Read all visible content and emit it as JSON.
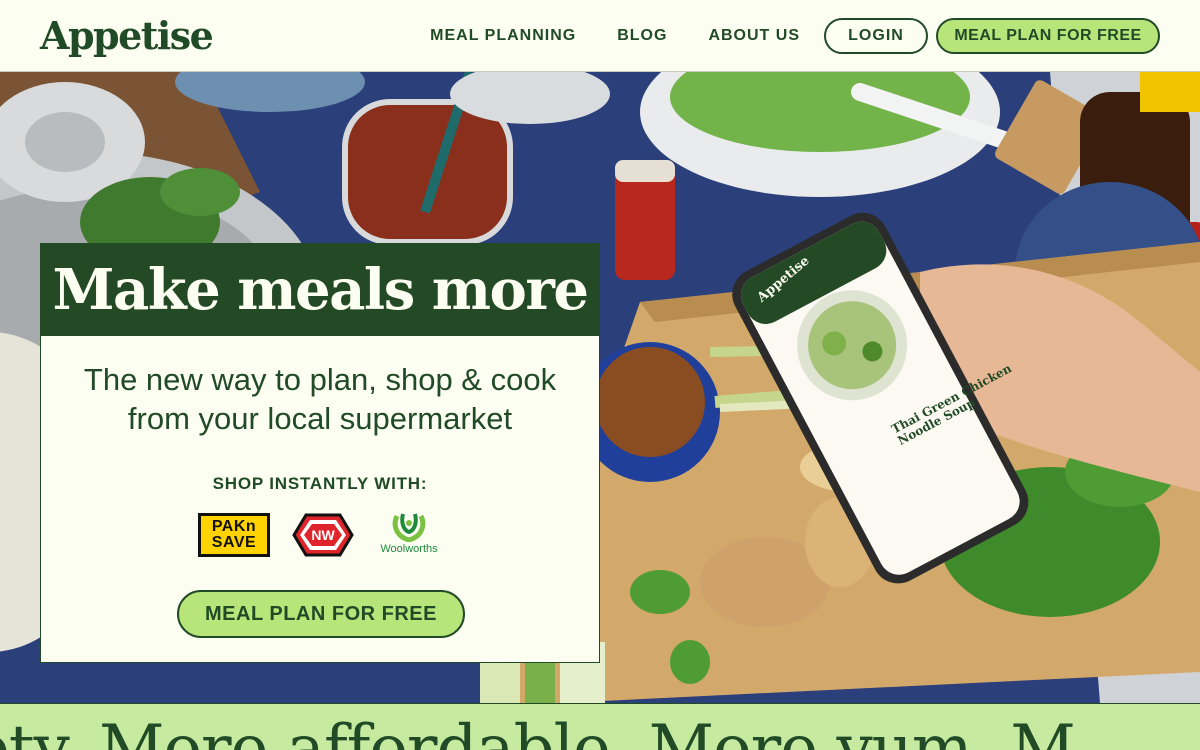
{
  "header": {
    "logo": "Appetise",
    "nav": [
      "MEAL PLANNING",
      "BLOG",
      "ABOUT US"
    ],
    "login_label": "LOGIN",
    "cta_label": "MEAL PLAN FOR FREE"
  },
  "hero": {
    "title": "Make meals more",
    "subtitle_line1": "The new way to plan, shop & cook",
    "subtitle_line2": "from your local supermarket",
    "shop_label": "SHOP INSTANTLY WITH:",
    "stores": {
      "paknsave_line1": "PAKn",
      "paknsave_line2": "SAVE",
      "newworld": "NW",
      "woolworths": "Woolworths"
    },
    "cta_label": "MEAL PLAN FOR FREE"
  },
  "phone": {
    "app_name": "Appetise",
    "recipe_title_line1": "Thai Green Chicken",
    "recipe_title_line2": "Noodle Soup"
  },
  "marquee": {
    "text": "ety. More affordable. More yum. M"
  },
  "colors": {
    "brand_green": "#214a26",
    "accent_lime": "#b8e57a",
    "cream": "#fdfef2",
    "marquee_bg": "#c6eba0"
  }
}
